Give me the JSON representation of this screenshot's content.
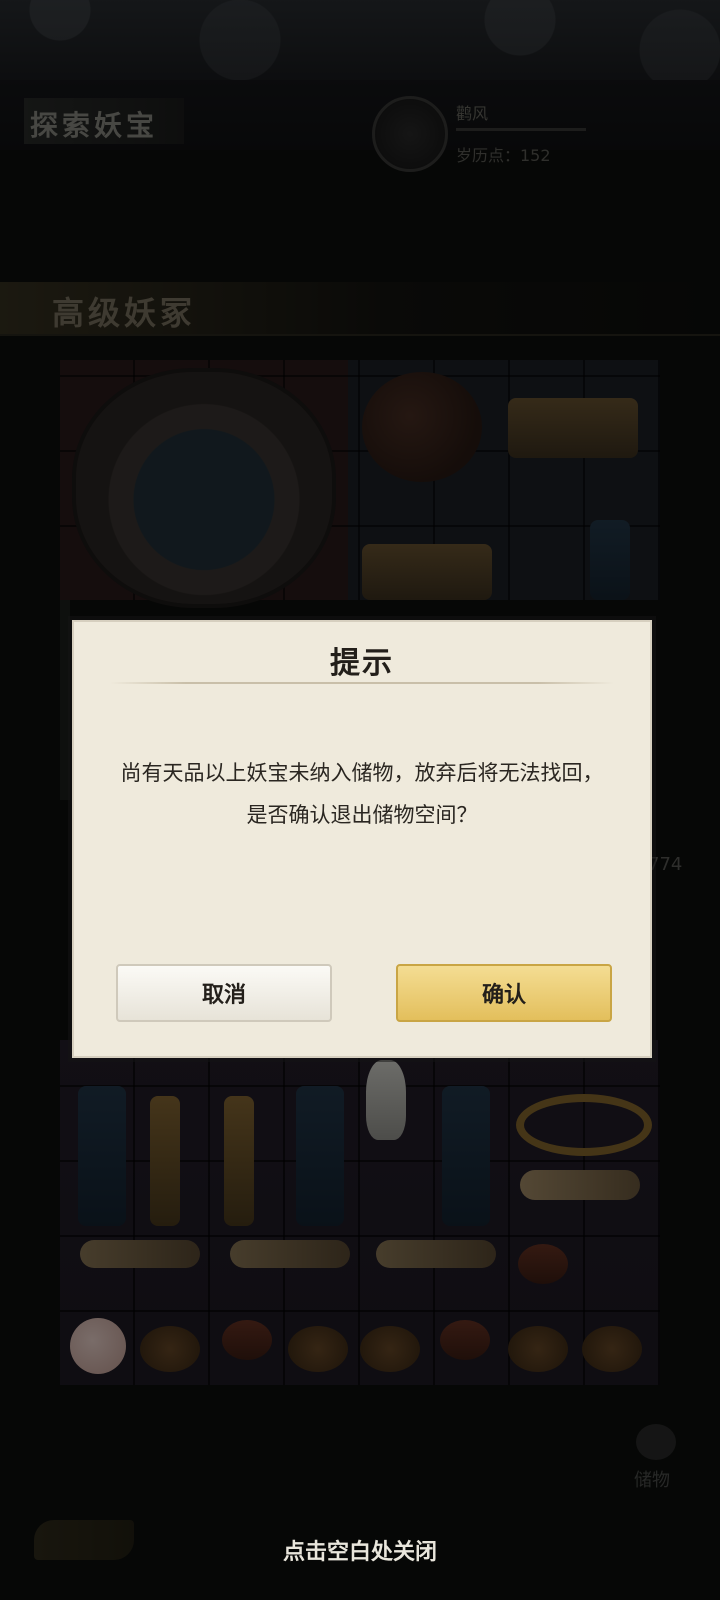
{
  "header": {
    "title": "探索妖宝",
    "player_name": "鹳风",
    "player_points": "岁历点：152"
  },
  "section": {
    "title": "高级妖冢"
  },
  "side_counter": "774",
  "storage": {
    "label": "储物"
  },
  "dialog": {
    "title": "提示",
    "message": "尚有天品以上妖宝未纳入储物，放弃后将无法找回，是否确认退出储物空间？",
    "cancel_label": "取消",
    "confirm_label": "确认"
  },
  "close_hint": "点击空白处关闭",
  "colors": {
    "dialog_bg": "#efeadc",
    "confirm_gold": "#e3bf5c",
    "cancel_white": "#f3f0e8"
  }
}
